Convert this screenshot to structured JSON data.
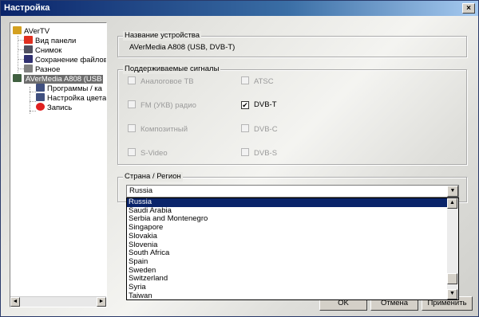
{
  "window": {
    "title": "Настройка",
    "close_glyph": "×"
  },
  "tree": {
    "items": [
      {
        "label": "AVerTV",
        "icon": "avertv-icon",
        "color": "#d4a020",
        "selected": false
      },
      {
        "label": "Вид панели",
        "icon": "panel-view-icon",
        "color": "#e03020",
        "selected": false
      },
      {
        "label": "Снимок",
        "icon": "camera-icon",
        "color": "#505060",
        "selected": false
      },
      {
        "label": "Сохранение файлов",
        "icon": "floppy-icon",
        "color": "#303070",
        "selected": false
      },
      {
        "label": "Разное",
        "icon": "misc-icon",
        "color": "#808080",
        "selected": false
      },
      {
        "label": "AVerMedia A808 (USB",
        "icon": "device-icon",
        "color": "#406040",
        "selected": true
      },
      {
        "label": "Программы / ка",
        "icon": "channels-icon",
        "color": "#405080",
        "selected": false
      },
      {
        "label": "Настройка цвета",
        "icon": "color-settings-icon",
        "color": "#405080",
        "selected": false
      },
      {
        "label": "Запись",
        "icon": "record-icon",
        "color": "#e02020",
        "selected": false
      }
    ],
    "scroll_left": "◄",
    "scroll_right": "►"
  },
  "device": {
    "group_title": "Название устройства",
    "name": "AVerMedia A808 (USB, DVB-T)"
  },
  "signals": {
    "group_title": "Поддерживаемые сигналы",
    "items": [
      {
        "label": "Аналоговое ТВ",
        "checked": false,
        "enabled": false
      },
      {
        "label": "ATSC",
        "checked": false,
        "enabled": false
      },
      {
        "label": "FM (УКВ) радио",
        "checked": false,
        "enabled": false
      },
      {
        "label": "DVB-T",
        "checked": true,
        "enabled": true
      },
      {
        "label": "Композитный",
        "checked": false,
        "enabled": false
      },
      {
        "label": "DVB-C",
        "checked": false,
        "enabled": false
      },
      {
        "label": "S-Video",
        "checked": false,
        "enabled": false
      },
      {
        "label": "DVB-S",
        "checked": false,
        "enabled": false
      }
    ],
    "check_glyph": "✔"
  },
  "region": {
    "group_title": "Страна / Регион",
    "selected": "Russia",
    "arrow": "▼",
    "options": [
      "Russia",
      "Saudi Arabia",
      "Serbia and Montenegro",
      "Singapore",
      "Slovakia",
      "Slovenia",
      "South Africa",
      "Spain",
      "Sweden",
      "Switzerland",
      "Syria",
      "Taiwan"
    ],
    "scroll_up": "▲",
    "scroll_down": "▼",
    "highlight_color": "#0a246a"
  },
  "buttons": {
    "ok": "OK",
    "cancel": "Отмена",
    "apply": "Применить"
  }
}
